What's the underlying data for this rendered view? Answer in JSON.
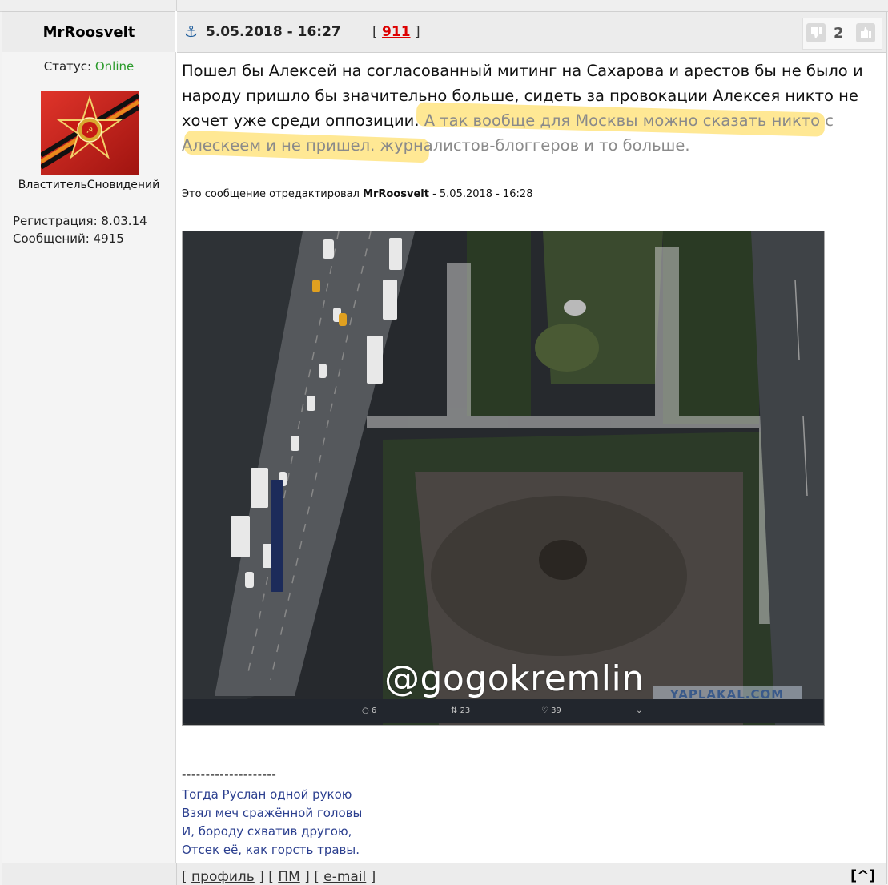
{
  "post": {
    "username": "MrRoosvelt",
    "anchor_glyph": "⚓",
    "date": "5.05.2018 - 16:27",
    "post_number_open": "[ ",
    "post_number": "911",
    "post_number_close": " ]",
    "votes": "2",
    "status_label": "Статус: ",
    "status_value": "Online",
    "rank": "ВластительСновидений",
    "registration": "Регистрация: 8.03.14",
    "messages_count": "Сообщений: 4915",
    "message_part1": "Пошел бы Алексей на согласованный митинг на Сахарова и арестов бы не было и народу пришло бы значительно больше, сидеть за провокации Алексея никто не хочет уже среди оппозиции. ",
    "message_part2": "А так вообще для Москвы можно сказать никто с Алескеем и не пришел. журналистов-блоггеров и то больше.",
    "edited_prefix": "Это сообщение отредактировал ",
    "edited_user": "MrRoosvelt",
    "edited_suffix": " - 5.05.2018 - 16:28",
    "image": {
      "watermark": "@gogokremlin",
      "watermark2": "YAPLAKAL.COM",
      "replies": "6",
      "retweets": "23",
      "likes": "39"
    },
    "signature_line": "--------------------",
    "signature": [
      "Тогда Руслан одной рукою",
      "Взял меч сражённой головы",
      "И, бороду схватив другою,",
      "Отсек её, как горсть травы."
    ],
    "footer": {
      "profile": "профиль",
      "pm": "ПМ",
      "email": "e-mail",
      "to_top": "[^]"
    }
  },
  "colors": {
    "online": "#2a9a2a",
    "post_number": "#d00000",
    "signature": "#2b3f8f",
    "highlight": "#ffd63c"
  }
}
